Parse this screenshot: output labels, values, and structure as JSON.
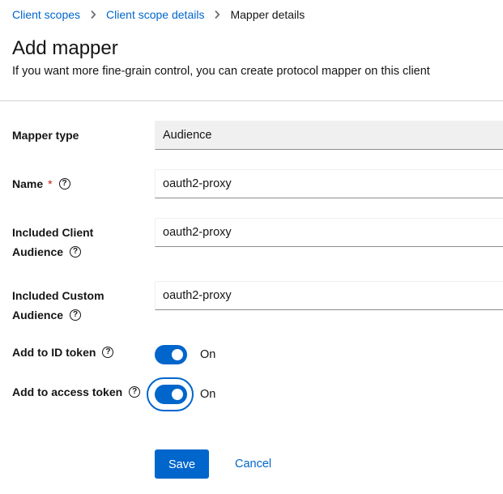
{
  "breadcrumb": {
    "items": [
      {
        "label": "Client scopes"
      },
      {
        "label": "Client scope details"
      },
      {
        "label": "Mapper details"
      }
    ]
  },
  "header": {
    "title": "Add mapper",
    "subtitle": "If you want more fine-grain control, you can create protocol mapper on this client"
  },
  "form": {
    "mapper_type": {
      "label": "Mapper type",
      "value": "Audience"
    },
    "name": {
      "label": "Name",
      "required_mark": "*",
      "value": "oauth2-proxy"
    },
    "included_client_audience": {
      "label_line1": "Included Client",
      "label_line2": "Audience",
      "value": "oauth2-proxy"
    },
    "included_custom_audience": {
      "label_line1": "Included Custom",
      "label_line2": "Audience",
      "value": "oauth2-proxy"
    },
    "add_to_id_token": {
      "label": "Add to ID token",
      "state_label": "On",
      "checked": true
    },
    "add_to_access_token": {
      "label": "Add to access token",
      "state_label": "On",
      "checked": true
    }
  },
  "actions": {
    "save_label": "Save",
    "cancel_label": "Cancel"
  },
  "colors": {
    "accent": "#0066cc",
    "required": "#c9190b",
    "readonly_bg": "#f0f0f0"
  },
  "icons": {
    "separator": "chevron-right-icon",
    "help": "help-circle-icon"
  }
}
